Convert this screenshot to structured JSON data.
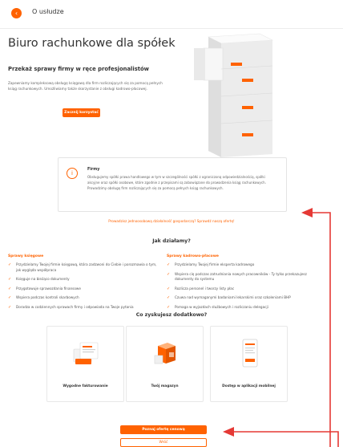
{
  "header": {
    "title": "O usłudze",
    "back_icon": "chevron-left-icon"
  },
  "hero": {
    "title": "Biuro rachunkowe dla spółek",
    "subtitle": "Przekaż sprawy firmy w ręce profesjonalistów",
    "description": "Zapewniamy kompleksową obsługę księgową dla firm rozliczających się za pomocą pełnych ksiąg rachunkowych. Umożliwiamy także skorzystanie z obsługi kadrowo-płacowej.",
    "button_label": "Zacznij korzystać"
  },
  "info_card": {
    "title": "Firmy",
    "text": "Obsługujemy spółki prawa handlowego w tym w szczególności spółki z ograniczoną odpowiedzialnością, spółki akcyjne oraz spółki osobowe, które zgodnie z przepisami są zobowiązane do prowadzenia ksiąg rachunkowych. Prowadzimy obsługę firm rozliczających się za pomocą pełnych ksiąg rachunkowych."
  },
  "promo_link": "Prowadzisz jednoosobową działalność gospodarczą? Sprawdź naszą ofertę!",
  "how": {
    "title": "Jak działamy?",
    "accounting": {
      "title": "Sprawy księgowe",
      "items": [
        "Przydzielamy Twojej firmie księgową, która zadzwoni do Ciebie i porozmawia o tym, jak wygląda współpraca",
        "Księguje na bieżąco dokumenty",
        "Przygotowuje sprawozdania finansowe",
        "Wspiera podczas kontroli skarbowych",
        "Doradza w codziennych sprawach firmy i odpowiada na Twoje pytania"
      ]
    },
    "hr": {
      "title": "Sprawy kadrowo-płacowe",
      "items": [
        "Przydzielamy Twojej firmie eksperta kadrowego",
        "Wspiera cię podczas zatrudniania nowych pracowników - Ty tylko przekazujesz dokumenty do systemu",
        "Rozlicza personel i tworzy listy płac",
        "Czuwa nad wymaganymi badaniami lekarskimi oraz szkoleniami BHP",
        "Pomaga w wyjazdach służbowych i rozliczaniu delegacji"
      ]
    }
  },
  "extras": {
    "title": "Co zyskujesz dodatkowo?",
    "tiles": [
      {
        "label": "Wygodne fakturowanie",
        "icon": "invoice-icon"
      },
      {
        "label": "Twój magazyn",
        "icon": "warehouse-icon"
      },
      {
        "label": "Dostęp w aplikacji mobilnej",
        "icon": "mobile-app-icon"
      }
    ]
  },
  "buttons": {
    "offer": "Poznaj ofertę cenową",
    "back": "Wróć"
  },
  "colors": {
    "accent": "#ff6200",
    "annotation": "#e53935"
  }
}
